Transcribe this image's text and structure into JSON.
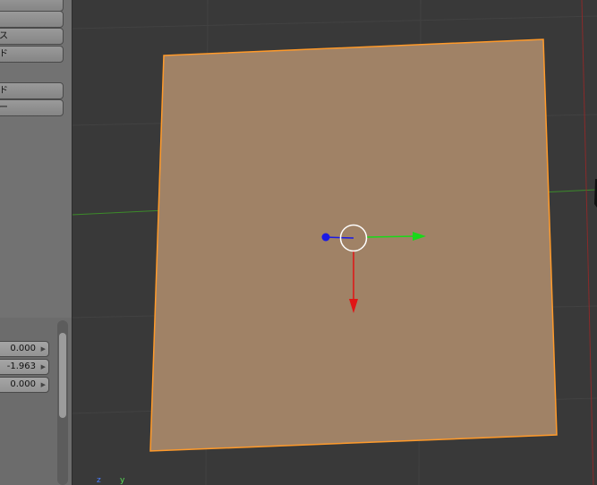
{
  "toolshelf": {
    "buttons": [
      {
        "label": ""
      },
      {
        "label": ""
      },
      {
        "label": "ス"
      },
      {
        "label": "ド"
      },
      {
        "label": "ー"
      }
    ]
  },
  "properties": {
    "values": [
      "0.000",
      "-1.963",
      "0.000"
    ]
  },
  "viewport": {
    "axis_hints": [
      "z",
      "y"
    ],
    "colors": {
      "background": "#393939",
      "plane_fill": "#a08266",
      "selection_outline": "#ff9a2a",
      "axis_x": "#e01515",
      "axis_y": "#19d919",
      "axis_z": "#1a1ae6"
    }
  }
}
